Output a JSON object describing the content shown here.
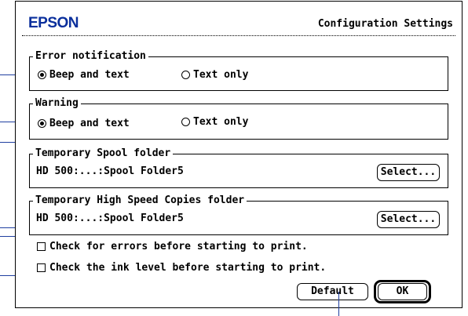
{
  "header": {
    "logo_text": "EPSON",
    "title": "Configuration Settings"
  },
  "error_notification": {
    "label": "Error notification",
    "options": [
      {
        "label": "Beep and text",
        "selected": true
      },
      {
        "label": "Text only",
        "selected": false
      }
    ]
  },
  "warning": {
    "label": "Warning",
    "options": [
      {
        "label": "Beep and text",
        "selected": true
      },
      {
        "label": "Text only",
        "selected": false
      }
    ]
  },
  "spool_folder": {
    "label": "Temporary Spool folder",
    "path": "HD 500:...:Spool Folder5",
    "select_label": "Select..."
  },
  "high_speed_folder": {
    "label": "Temporary High Speed Copies folder",
    "path": "HD 500:...:Spool Folder5",
    "select_label": "Select..."
  },
  "checks": {
    "errors_label": "Check for errors before starting to print.",
    "errors_checked": false,
    "ink_label": "Check the ink level before starting to print.",
    "ink_checked": false
  },
  "buttons": {
    "default_label": "Default",
    "ok_label": "OK"
  },
  "colors": {
    "logo": "#0a2f9c",
    "callout": "#1f3fa0"
  }
}
